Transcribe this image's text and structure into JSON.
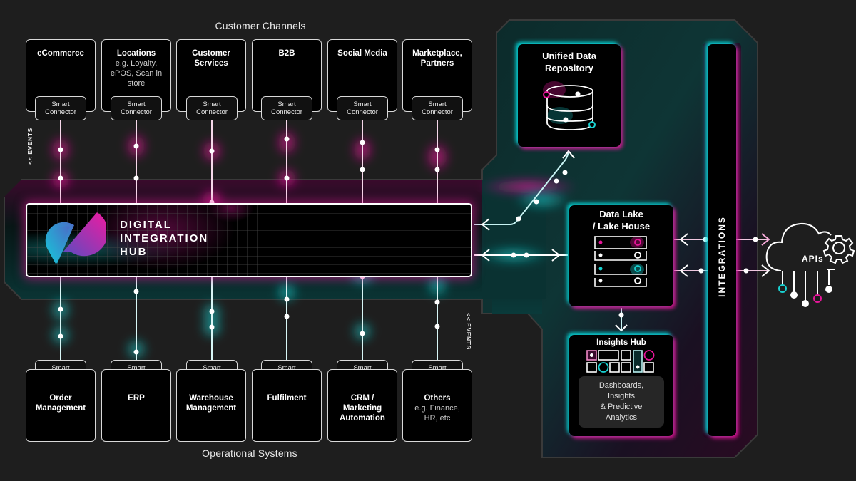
{
  "titles": {
    "customer_channels": "Customer Channels",
    "operational_systems": "Operational Systems"
  },
  "events_label": "<< EVENTS",
  "connector_label_line1": "Smart",
  "connector_label_line2": "Connector",
  "customer_channels": [
    {
      "title": "eCommerce",
      "subtitle": ""
    },
    {
      "title": "Locations",
      "subtitle": "e.g. Loyalty, ePOS, Scan in store"
    },
    {
      "title": "Customer Services",
      "subtitle": ""
    },
    {
      "title": "B2B",
      "subtitle": ""
    },
    {
      "title": "Social Media",
      "subtitle": ""
    },
    {
      "title": "Marketplace, Partners",
      "subtitle": ""
    }
  ],
  "operational_systems": [
    {
      "title": "Order Management",
      "subtitle": ""
    },
    {
      "title": "ERP",
      "subtitle": ""
    },
    {
      "title": "Warehouse Management",
      "subtitle": ""
    },
    {
      "title": "Fulfilment",
      "subtitle": ""
    },
    {
      "title": "CRM / Marketing Automation",
      "subtitle": ""
    },
    {
      "title": "Others",
      "subtitle": "e.g. Finance, HR, etc"
    }
  ],
  "hub": {
    "line1": "DIGITAL",
    "line2": "INTEGRATION",
    "line3": "HUB"
  },
  "unified_repo": {
    "line1": "Unified Data",
    "line2": "Repository"
  },
  "data_lake": {
    "line1": "Data Lake",
    "line2": "/ Lake House"
  },
  "insights_hub": {
    "title": "Insights Hub",
    "desc_line1": "Dashboards,",
    "desc_line2": "Insights",
    "desc_line3": "& Predictive",
    "desc_line4": "Analytics"
  },
  "integrations_label": "INTEGRATIONS",
  "apis_label": "APIs",
  "colors": {
    "background": "#1e1e1e",
    "panel": "#000000",
    "magenta": "#e8159a",
    "cyan": "#19d3d3",
    "line": "#ffffff"
  }
}
